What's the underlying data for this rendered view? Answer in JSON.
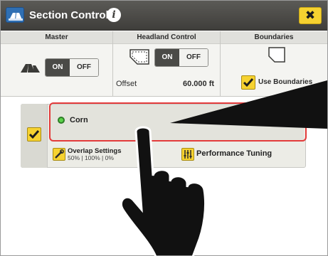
{
  "title": "Section Control",
  "close_label": "✖",
  "master": {
    "header": "Master",
    "on": "ON",
    "off": "OFF"
  },
  "headland": {
    "header": "Headland Control",
    "on": "ON",
    "off": "OFF",
    "offset_label": "Offset",
    "offset_value": "60.000 ft"
  },
  "boundaries": {
    "header": "Boundaries",
    "use_label": "Use Boundaries"
  },
  "row": {
    "crop_name": "Corn",
    "overlap_title": "Overlap Settings",
    "overlap_values": "50% | 100% | 0%",
    "performance_label": "Performance Tuning"
  },
  "colors": {
    "accent": "#f6d230",
    "titlebar": "#4a4946",
    "highlight": "#e33b3b",
    "status_led": "#5bd34a"
  },
  "icons": [
    "app-icon",
    "info-icon",
    "close-icon",
    "implement-icon",
    "headland-icon",
    "boundary-icon",
    "checkmark-icon",
    "wrench-icon",
    "tuning-icon",
    "pointing-hand-icon",
    "pointer-arrow-icon"
  ]
}
